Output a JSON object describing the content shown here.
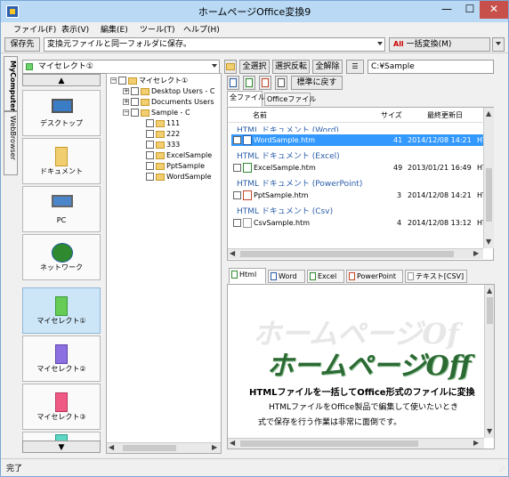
{
  "window": {
    "title": "ホームページOffice変換9",
    "minimize": "—",
    "maximize": "☐",
    "close": "✕"
  },
  "menu": [
    {
      "label": "ファイル(F)"
    },
    {
      "label": "表示(V)"
    },
    {
      "label": "編集(E)"
    },
    {
      "label": "ツール(T)"
    },
    {
      "label": "ヘルプ(H)"
    }
  ],
  "toolbar": {
    "save_dest_label": "保存先",
    "save_dest_value": "変換元ファイルと同一フォルダに保存。",
    "batch_convert_icon_text": "All",
    "batch_convert_label": "一括変換(M)"
  },
  "vtabs": {
    "my_computer": "MyComputer",
    "web_browser": "WebBrowser"
  },
  "sidepanel": {
    "dropdown_value": "マイセレクト①",
    "items": [
      {
        "label": "デスクトップ"
      },
      {
        "label": "ドキュメント"
      },
      {
        "label": "PC"
      },
      {
        "label": "ネットワーク"
      },
      {
        "label": "マイセレクト①"
      },
      {
        "label": "マイセレクト②"
      },
      {
        "label": "マイセレクト③"
      }
    ]
  },
  "tree": {
    "root": "マイセレクト①",
    "nodes": [
      {
        "label": "Desktop Users - C"
      },
      {
        "label": "Documents Users"
      },
      {
        "label": "Sample - C"
      },
      {
        "label": "111"
      },
      {
        "label": "222"
      },
      {
        "label": "333"
      },
      {
        "label": "ExcelSample"
      },
      {
        "label": "PptSample"
      },
      {
        "label": "WordSample"
      }
    ]
  },
  "actions": {
    "select_all": "全選択",
    "invert": "選択反転",
    "clear_all": "全解除",
    "path": "C:¥Sample",
    "restore": "標準に戻す"
  },
  "file_tabs": {
    "all": "全ファイル",
    "office": "Officeファイル"
  },
  "file_list": {
    "headers": {
      "name": "名前",
      "size": "サイズ",
      "modified": "最終更新日"
    },
    "groups": [
      {
        "title": "HTML ドキュメント (Word)",
        "file": "WordSample.htm",
        "size": "41",
        "date": "2014/12/08 14:21",
        "type": "HT"
      },
      {
        "title": "HTML ドキュメント (Excel)",
        "file": "ExcelSample.htm",
        "size": "49",
        "date": "2013/01/21 16:49",
        "type": "HT"
      },
      {
        "title": "HTML ドキュメント (PowerPoint)",
        "file": "PptSample.htm",
        "size": "3",
        "date": "2014/12/08 14:21",
        "type": "HT"
      },
      {
        "title": "HTML ドキュメント (Csv)",
        "file": "CsvSample.htm",
        "size": "4",
        "date": "2014/12/08 13:12",
        "type": "HT"
      }
    ]
  },
  "preview_tabs": [
    {
      "label": "Html"
    },
    {
      "label": "Word"
    },
    {
      "label": "Excel"
    },
    {
      "label": "PowerPoint"
    },
    {
      "label": "テキスト[CSV]"
    }
  ],
  "preview": {
    "logo_shadow": "ホームページOf",
    "logo_main": "ホームページOff",
    "heading": "HTMLファイルを一括してOffice形式のファイルに変換",
    "line1": "HTMLファイルをOffice製品で編集して使いたいとき",
    "line2": "式で保存を行う作業は非常に面倒です。"
  },
  "status": {
    "text": "完了"
  },
  "colors": {
    "selection": "#3399ff",
    "group_header": "#2a5daa",
    "logo_green": "#2b6a33"
  }
}
